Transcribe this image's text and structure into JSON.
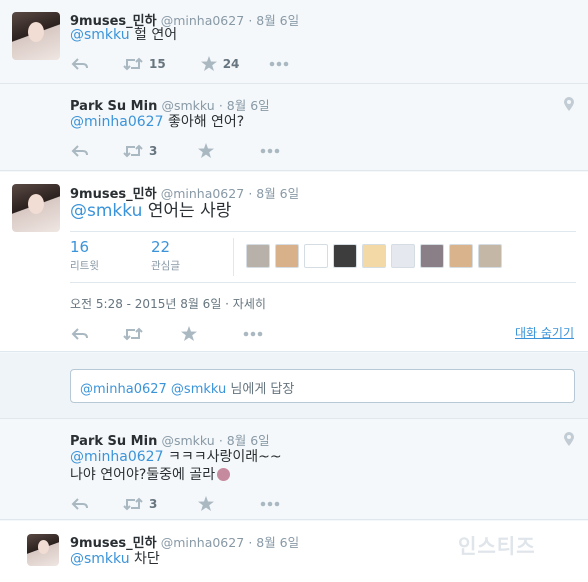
{
  "tweet1": {
    "name": "9muses_민하",
    "handle": "@minha0627",
    "time": "· 8월 6일",
    "mention": "@smkku",
    "text": "헐 연어",
    "retweets": "15",
    "likes": "24"
  },
  "tweet2": {
    "name": "Park Su Min",
    "handle": "@smkku",
    "time": "· 8월 6일",
    "mention": "@minha0627",
    "text": "좋아해 연어?",
    "retweets": "3"
  },
  "tweet3": {
    "name": "9muses_민하",
    "handle": "@minha0627",
    "time": "· 8월 6일",
    "mention": "@smkku",
    "text": "연어는 사랑",
    "retweet_count": "16",
    "retweet_label": "리트윗",
    "like_count": "22",
    "like_label": "관심글",
    "timestamp": "오전 5:28 - 2015년 8월 6일 · 자세히",
    "hide_conversation": "대화 숨기기",
    "liker_colors": [
      "#b7b1a9",
      "#d8b089",
      "#ffffff",
      "#3d3d3d",
      "#f2d9a6",
      "#e6e8f0",
      "#8a7f86",
      "#d9b38b",
      "#c5b7a5"
    ]
  },
  "reply": {
    "mention": "@minha0627 @smkku",
    "suffix": "님에게 답장"
  },
  "tweet4": {
    "name": "Park Su Min",
    "handle": "@smkku",
    "time": "· 8월 6일",
    "mention": "@minha0627",
    "text_line1": "ㅋㅋㅋ사랑이래~~",
    "text_line2": "나야 연어야?둘중에 골라",
    "retweets": "3"
  },
  "tweet5": {
    "name": "9muses_민하",
    "handle": "@minha0627",
    "time": "· 8월 6일",
    "mention": "@smkku",
    "text": "차단"
  },
  "watermark": "인스티즈",
  "colors": {
    "link": "#3b94d9",
    "muted": "#8899a6",
    "border": "#e1e8ed"
  },
  "icons": [
    "reply-icon",
    "retweet-icon",
    "star-icon",
    "more-icon",
    "location-pin-icon"
  ]
}
